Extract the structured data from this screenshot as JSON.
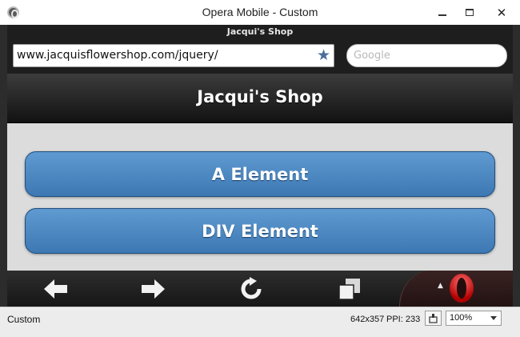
{
  "window": {
    "title": "Opera Mobile - Custom",
    "close_glyph": "✕",
    "icons": {
      "app": "opera-app-icon",
      "minimize": "minimize-icon",
      "maximize": "maximize-icon",
      "close": "close-icon"
    }
  },
  "browser": {
    "tab_title": "Jacqui's Shop",
    "address_value": "www.jacquisflowershop.com/jquery/",
    "bookmark_icon": "star-icon",
    "search_placeholder": "Google"
  },
  "page": {
    "header_title": "Jacqui's Shop",
    "buttons": [
      {
        "label": "A Element"
      },
      {
        "label": "DIV Element"
      }
    ],
    "colors": {
      "button": "#4a86c0",
      "header": "#1a1a1a",
      "content_bg": "#dcdcdc"
    }
  },
  "toolbar": {
    "icons": [
      "back-arrow-icon",
      "forward-arrow-icon",
      "reload-icon",
      "tabs-icon",
      "opera-menu-icon"
    ],
    "menu_glyph": "▲"
  },
  "statusbar": {
    "profile": "Custom",
    "resolution": "642x357",
    "ppi": "PPI: 233",
    "zoom": "100%"
  }
}
